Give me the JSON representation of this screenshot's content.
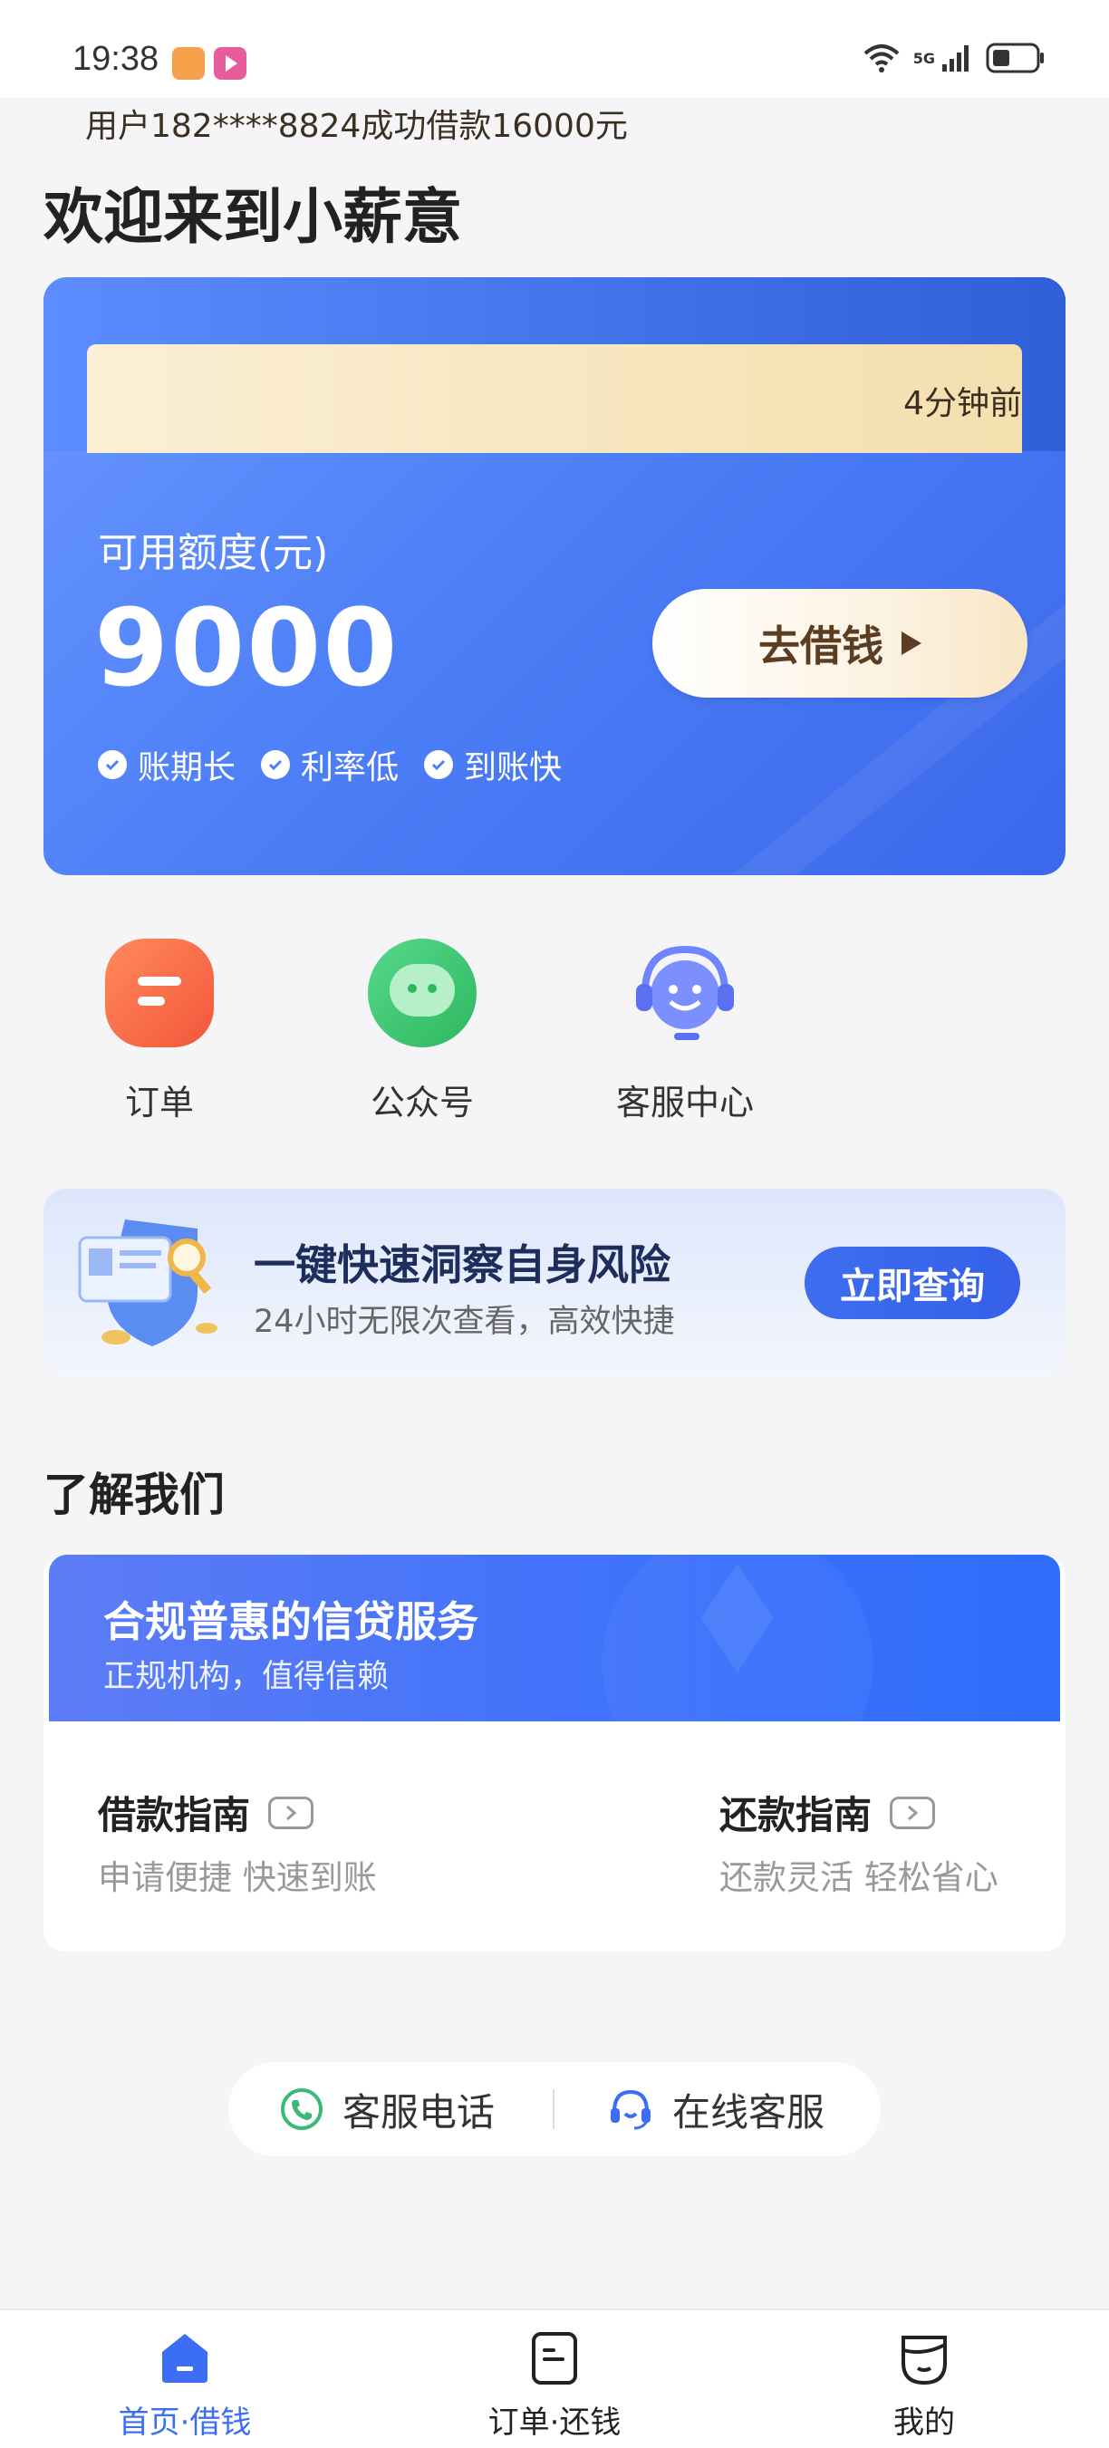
{
  "status_bar": {
    "time": "19:38",
    "network": "5G"
  },
  "page": {
    "welcome": "欢迎来到小薪意"
  },
  "credit_card": {
    "notice_text": "用户182****8824成功借款16000元",
    "notice_time": "4分钟前",
    "available_label": "可用额度(元)",
    "available_amount": "9000",
    "borrow_button": "去借钱",
    "perks": [
      "账期长",
      "利率低",
      "到账快"
    ]
  },
  "shortcuts": [
    {
      "label": "订单",
      "icon": "order-icon",
      "color": "#f7674a"
    },
    {
      "label": "公众号",
      "icon": "wechat-icon",
      "color": "#3ec46d"
    },
    {
      "label": "客服中心",
      "icon": "customer-service-icon",
      "color": "#6f84ff"
    }
  ],
  "risk_banner": {
    "title": "一键快速洞察自身风险",
    "subtitle": "24小时无限次查看，高效快捷",
    "button": "立即查询"
  },
  "about": {
    "section_title": "了解我们",
    "head_title": "合规普惠的信贷服务",
    "head_subtitle": "正规机构，值得信赖",
    "borrow_guide_title": "借款指南",
    "borrow_guide_sub": "申请便捷 快速到账",
    "repay_guide_title": "还款指南",
    "repay_guide_sub": "还款灵活 轻松省心"
  },
  "contact": {
    "phone": "客服电话",
    "online": "在线客服"
  },
  "bottom_nav": [
    {
      "label": "首页·借钱",
      "active": true
    },
    {
      "label": "订单·还钱",
      "active": false
    },
    {
      "label": "我的",
      "active": false
    }
  ],
  "colors": {
    "accent": "#3f73f3",
    "nav_active": "#3b6ef5",
    "nav_inactive": "#222222"
  }
}
